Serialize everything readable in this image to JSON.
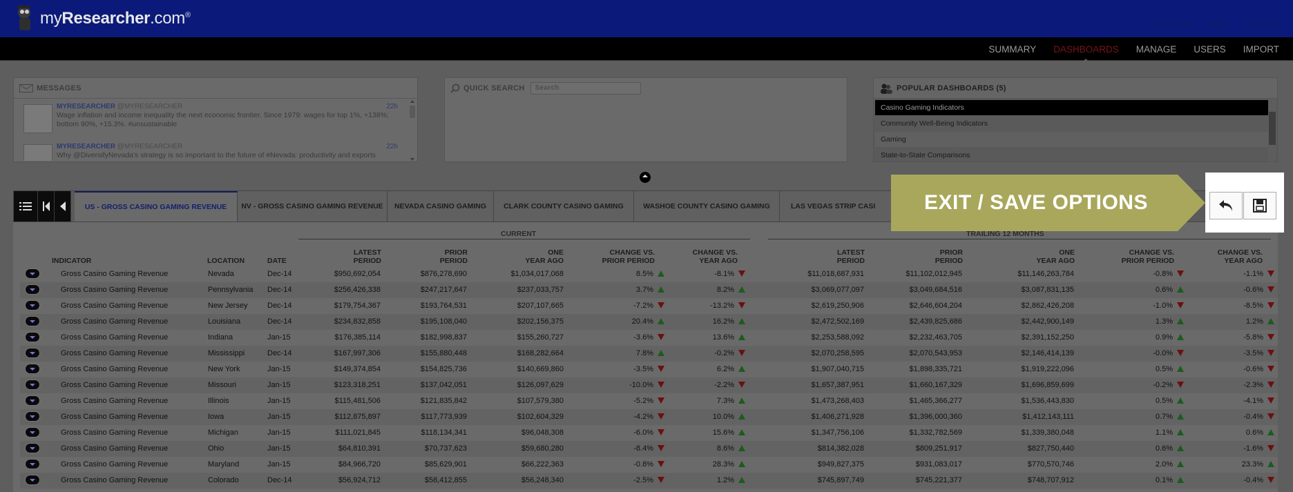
{
  "header": {
    "brand_prefix": "my",
    "brand_bold": "Researcher",
    "brand_suffix": ".com",
    "brand_reg": "®",
    "links": [
      "ACCOUNT",
      "HELP",
      "LOG OUT"
    ]
  },
  "nav": {
    "items": [
      "SUMMARY",
      "DASHBOARDS",
      "MANAGE",
      "USERS",
      "IMPORT"
    ],
    "active": "DASHBOARDS"
  },
  "messages": {
    "title": "MESSAGES",
    "items": [
      {
        "user": "MYRESEARCHER",
        "handle": "@MYRESEARCHER",
        "age": "22h",
        "text": "Wage inflation and income inequality the next economic frontier. Since 1979: wages for top 1%, +138%; bottom 90%, +15.3%. #unsustainable"
      },
      {
        "user": "MYRESEARCHER",
        "handle": "@MYRESEARCHER",
        "age": "22h",
        "text": "Why @DiversifyNevada's strategy is so important to the future of #Nevada: productivity and exports"
      }
    ]
  },
  "quick_search": {
    "title": "QUICK SEARCH",
    "placeholder": "Search"
  },
  "popular": {
    "title": "POPULAR DASHBOARDS (5)",
    "items": [
      "Casino Gaming Indicators",
      "Community Well-Being Indicators",
      "Gaming",
      "State-to-State Comparisons"
    ]
  },
  "tabs": [
    "US - GROSS CASINO GAMING REVENUE",
    "NV - GROSS CASINO GAMING REVENUE",
    "NEVADA CASINO GAMING",
    "CLARK COUNTY CASINO GAMING",
    "WASHOE COUNTY CASINO GAMING",
    "LAS VEGAS STRIP CASI"
  ],
  "callout": {
    "text": "EXIT / SAVE OPTIONS",
    "color": "#a9a75c"
  },
  "table": {
    "groups": {
      "current": "CURRENT",
      "trailing": "TRAILING 12 MONTHS"
    },
    "headers": {
      "indicator": "INDICATOR",
      "location": "LOCATION",
      "date": "DATE",
      "latest_1": "LATEST",
      "latest_2": "PERIOD",
      "prior_1": "PRIOR",
      "prior_2": "PERIOD",
      "one_1": "ONE",
      "one_2": "YEAR AGO",
      "cvp_1": "CHANGE VS.",
      "cvp_2": "PRIOR PERIOD",
      "cvy_1": "CHANGE VS.",
      "cvy_2": "YEAR AGO"
    },
    "rows": [
      {
        "indicator": "Gross Casino Gaming Revenue",
        "location": "Nevada",
        "date": "Dec-14",
        "latest": "$950,692,054",
        "prior": "$876,278,690",
        "year_ago": "$1,034,017,068",
        "chg_prior": "8.5%",
        "chg_prior_dir": "up",
        "chg_year": "-8.1%",
        "chg_year_dir": "down",
        "t_latest": "$11,018,687,931",
        "t_prior": "$11,102,012,945",
        "t_year_ago": "$11,146,263,784",
        "t_chg_prior": "-0.8%",
        "t_chg_prior_dir": "down",
        "t_chg_year": "-1.1%",
        "t_chg_year_dir": "down"
      },
      {
        "indicator": "Gross Casino Gaming Revenue",
        "location": "Pennsylvania",
        "date": "Dec-14",
        "latest": "$256,426,338",
        "prior": "$247,217,647",
        "year_ago": "$237,033,757",
        "chg_prior": "3.7%",
        "chg_prior_dir": "up",
        "chg_year": "8.2%",
        "chg_year_dir": "up",
        "t_latest": "$3,069,077,097",
        "t_prior": "$3,049,684,516",
        "t_year_ago": "$3,087,831,135",
        "t_chg_prior": "0.6%",
        "t_chg_prior_dir": "up",
        "t_chg_year": "-0.6%",
        "t_chg_year_dir": "down"
      },
      {
        "indicator": "Gross Casino Gaming Revenue",
        "location": "New Jersey",
        "date": "Dec-14",
        "latest": "$179,754,367",
        "prior": "$193,764,531",
        "year_ago": "$207,107,665",
        "chg_prior": "-7.2%",
        "chg_prior_dir": "down",
        "chg_year": "-13.2%",
        "chg_year_dir": "down",
        "t_latest": "$2,619,250,906",
        "t_prior": "$2,646,604,204",
        "t_year_ago": "$2,862,426,208",
        "t_chg_prior": "-1.0%",
        "t_chg_prior_dir": "down",
        "t_chg_year": "-8.5%",
        "t_chg_year_dir": "down"
      },
      {
        "indicator": "Gross Casino Gaming Revenue",
        "location": "Louisiana",
        "date": "Dec-14",
        "latest": "$234,832,858",
        "prior": "$195,108,040",
        "year_ago": "$202,156,375",
        "chg_prior": "20.4%",
        "chg_prior_dir": "up",
        "chg_year": "16.2%",
        "chg_year_dir": "up",
        "t_latest": "$2,472,502,169",
        "t_prior": "$2,439,825,686",
        "t_year_ago": "$2,442,900,149",
        "t_chg_prior": "1.3%",
        "t_chg_prior_dir": "up",
        "t_chg_year": "1.2%",
        "t_chg_year_dir": "up"
      },
      {
        "indicator": "Gross Casino Gaming Revenue",
        "location": "Indiana",
        "date": "Jan-15",
        "latest": "$176,385,114",
        "prior": "$182,998,837",
        "year_ago": "$155,260,727",
        "chg_prior": "-3.6%",
        "chg_prior_dir": "down",
        "chg_year": "13.6%",
        "chg_year_dir": "up",
        "t_latest": "$2,253,588,092",
        "t_prior": "$2,232,463,705",
        "t_year_ago": "$2,391,152,250",
        "t_chg_prior": "0.9%",
        "t_chg_prior_dir": "up",
        "t_chg_year": "-5.8%",
        "t_chg_year_dir": "down"
      },
      {
        "indicator": "Gross Casino Gaming Revenue",
        "location": "Mississippi",
        "date": "Dec-14",
        "latest": "$167,997,306",
        "prior": "$155,880,448",
        "year_ago": "$168,282,664",
        "chg_prior": "7.8%",
        "chg_prior_dir": "up",
        "chg_year": "-0.2%",
        "chg_year_dir": "down",
        "t_latest": "$2,070,258,595",
        "t_prior": "$2,070,543,953",
        "t_year_ago": "$2,146,414,139",
        "t_chg_prior": "-0.0%",
        "t_chg_prior_dir": "down",
        "t_chg_year": "-3.5%",
        "t_chg_year_dir": "down"
      },
      {
        "indicator": "Gross Casino Gaming Revenue",
        "location": "New York",
        "date": "Jan-15",
        "latest": "$149,374,854",
        "prior": "$154,825,736",
        "year_ago": "$140,669,860",
        "chg_prior": "-3.5%",
        "chg_prior_dir": "down",
        "chg_year": "6.2%",
        "chg_year_dir": "up",
        "t_latest": "$1,907,040,715",
        "t_prior": "$1,898,335,721",
        "t_year_ago": "$1,919,222,096",
        "t_chg_prior": "0.5%",
        "t_chg_prior_dir": "up",
        "t_chg_year": "-0.6%",
        "t_chg_year_dir": "down"
      },
      {
        "indicator": "Gross Casino Gaming Revenue",
        "location": "Missouri",
        "date": "Jan-15",
        "latest": "$123,318,251",
        "prior": "$137,042,051",
        "year_ago": "$126,097,629",
        "chg_prior": "-10.0%",
        "chg_prior_dir": "down",
        "chg_year": "-2.2%",
        "chg_year_dir": "down",
        "t_latest": "$1,657,387,951",
        "t_prior": "$1,660,167,329",
        "t_year_ago": "$1,696,859,699",
        "t_chg_prior": "-0.2%",
        "t_chg_prior_dir": "down",
        "t_chg_year": "-2.3%",
        "t_chg_year_dir": "down"
      },
      {
        "indicator": "Gross Casino Gaming Revenue",
        "location": "Illinois",
        "date": "Jan-15",
        "latest": "$115,481,506",
        "prior": "$121,835,842",
        "year_ago": "$107,579,380",
        "chg_prior": "-5.2%",
        "chg_prior_dir": "down",
        "chg_year": "7.3%",
        "chg_year_dir": "up",
        "t_latest": "$1,473,268,403",
        "t_prior": "$1,465,366,277",
        "t_year_ago": "$1,536,443,830",
        "t_chg_prior": "0.5%",
        "t_chg_prior_dir": "up",
        "t_chg_year": "-4.1%",
        "t_chg_year_dir": "down"
      },
      {
        "indicator": "Gross Casino Gaming Revenue",
        "location": "Iowa",
        "date": "Jan-15",
        "latest": "$112,875,897",
        "prior": "$117,773,939",
        "year_ago": "$102,604,329",
        "chg_prior": "-4.2%",
        "chg_prior_dir": "down",
        "chg_year": "10.0%",
        "chg_year_dir": "up",
        "t_latest": "$1,406,271,928",
        "t_prior": "$1,396,000,360",
        "t_year_ago": "$1,412,143,111",
        "t_chg_prior": "0.7%",
        "t_chg_prior_dir": "up",
        "t_chg_year": "-0.4%",
        "t_chg_year_dir": "down"
      },
      {
        "indicator": "Gross Casino Gaming Revenue",
        "location": "Michigan",
        "date": "Jan-15",
        "latest": "$111,021,845",
        "prior": "$118,134,341",
        "year_ago": "$96,048,308",
        "chg_prior": "-6.0%",
        "chg_prior_dir": "down",
        "chg_year": "15.6%",
        "chg_year_dir": "up",
        "t_latest": "$1,347,756,106",
        "t_prior": "$1,332,782,569",
        "t_year_ago": "$1,339,380,048",
        "t_chg_prior": "1.1%",
        "t_chg_prior_dir": "up",
        "t_chg_year": "0.6%",
        "t_chg_year_dir": "up"
      },
      {
        "indicator": "Gross Casino Gaming Revenue",
        "location": "Ohio",
        "date": "Jan-15",
        "latest": "$64,810,391",
        "prior": "$70,737,623",
        "year_ago": "$59,680,280",
        "chg_prior": "-8.4%",
        "chg_prior_dir": "down",
        "chg_year": "8.6%",
        "chg_year_dir": "up",
        "t_latest": "$814,382,028",
        "t_prior": "$809,251,917",
        "t_year_ago": "$827,750,440",
        "t_chg_prior": "0.6%",
        "t_chg_prior_dir": "up",
        "t_chg_year": "-1.6%",
        "t_chg_year_dir": "down"
      },
      {
        "indicator": "Gross Casino Gaming Revenue",
        "location": "Maryland",
        "date": "Jan-15",
        "latest": "$84,966,720",
        "prior": "$85,629,901",
        "year_ago": "$66,222,363",
        "chg_prior": "-0.8%",
        "chg_prior_dir": "down",
        "chg_year": "28.3%",
        "chg_year_dir": "up",
        "t_latest": "$949,827,375",
        "t_prior": "$931,083,017",
        "t_year_ago": "$770,570,746",
        "t_chg_prior": "2.0%",
        "t_chg_prior_dir": "up",
        "t_chg_year": "23.3%",
        "t_chg_year_dir": "up"
      },
      {
        "indicator": "Gross Casino Gaming Revenue",
        "location": "Colorado",
        "date": "Dec-14",
        "latest": "$56,924,712",
        "prior": "$58,412,855",
        "year_ago": "$56,248,340",
        "chg_prior": "-2.5%",
        "chg_prior_dir": "down",
        "chg_year": "1.2%",
        "chg_year_dir": "up",
        "t_latest": "$745,897,749",
        "t_prior": "$745,221,377",
        "t_year_ago": "$748,707,912",
        "t_chg_prior": "0.1%",
        "t_chg_prior_dir": "up",
        "t_chg_year": "-0.4%",
        "t_chg_year_dir": "down"
      }
    ]
  }
}
